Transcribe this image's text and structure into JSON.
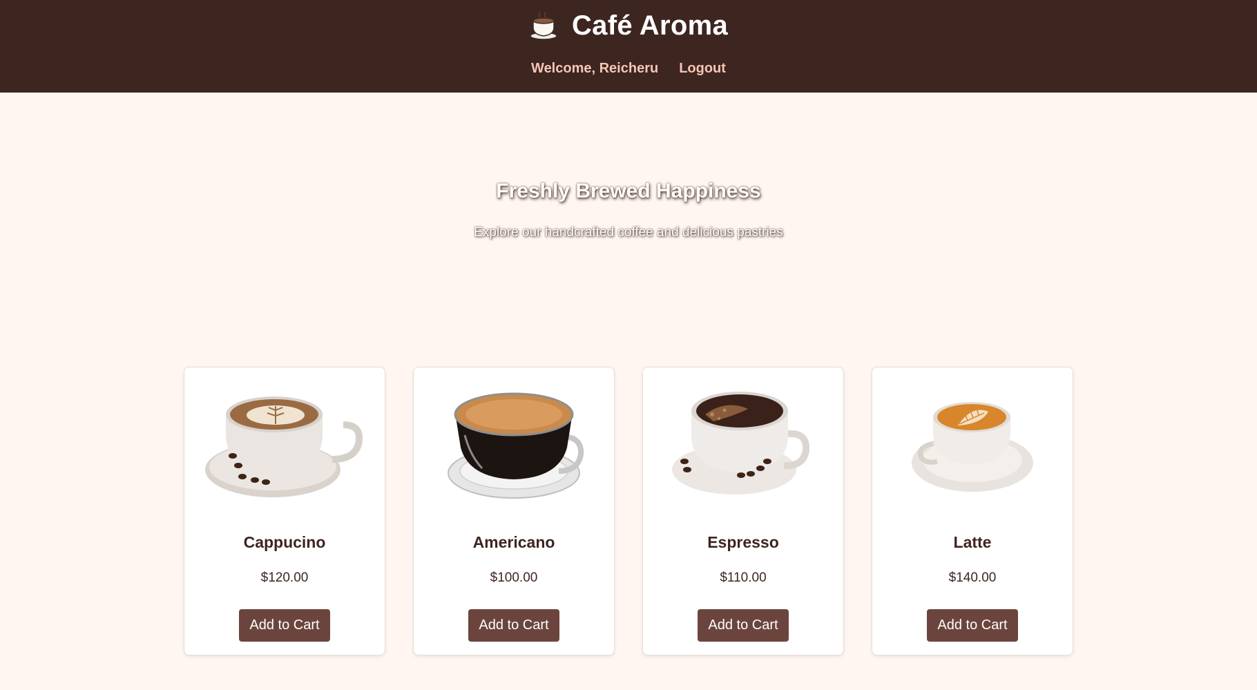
{
  "header": {
    "brand_title": "Café Aroma",
    "brand_icon": "coffee-cup-icon",
    "welcome_text": "Welcome, Reicheru",
    "logout_label": "Logout"
  },
  "hero": {
    "title": "Freshly Brewed Happiness",
    "subtitle": "Explore our handcrafted coffee and delicious pastries"
  },
  "products": [
    {
      "name": "Cappucino",
      "price": "$120.00",
      "button_label": "Add to Cart",
      "image": "cappuccino-cup-image"
    },
    {
      "name": "Americano",
      "price": "$100.00",
      "button_label": "Add to Cart",
      "image": "americano-glass-cup-image"
    },
    {
      "name": "Espresso",
      "price": "$110.00",
      "button_label": "Add to Cart",
      "image": "espresso-cup-image"
    },
    {
      "name": "Latte",
      "price": "$140.00",
      "button_label": "Add to Cart",
      "image": "latte-cup-image"
    }
  ],
  "colors": {
    "header_bg": "#3d2520",
    "page_bg": "#fff6f1",
    "nav_link": "#f4c7b4",
    "button_bg": "#6b453d",
    "text_dark": "#3d2520"
  }
}
